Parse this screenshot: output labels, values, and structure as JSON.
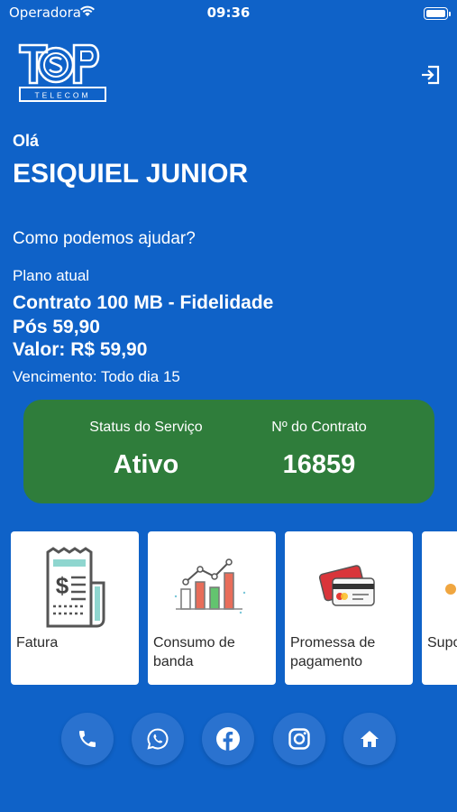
{
  "status_bar": {
    "carrier": "Operadora",
    "time": "09:36"
  },
  "header": {
    "logo_main": "TOP",
    "logo_sub": "TELECOM",
    "logout_icon": "logout-icon"
  },
  "user": {
    "greeting": "Olá",
    "name": "ESIQUIEL JUNIOR",
    "help_text": "Como podemos ajudar?"
  },
  "plan": {
    "label": "Plano atual",
    "name": "Contrato 100 MB - Fidelidade Pós 59,90",
    "value": "Valor: R$ 59,90",
    "due_date": "Vencimento: Todo dia 15"
  },
  "status_card": {
    "service_status_label": "Status do Serviço",
    "service_status_value": "Ativo",
    "contract_label": "Nº do Contrato",
    "contract_value": "16859",
    "color": "#2f7d3b"
  },
  "services": [
    {
      "label": "Fatura",
      "icon": "invoice-icon"
    },
    {
      "label": "Consumo de banda",
      "icon": "bandwidth-chart-icon"
    },
    {
      "label": "Promessa de pagamento",
      "icon": "credit-cards-icon"
    },
    {
      "label": "Suporte",
      "icon": "support-icon"
    }
  ],
  "bottom_actions": [
    {
      "icon": "phone-icon"
    },
    {
      "icon": "whatsapp-icon"
    },
    {
      "icon": "facebook-icon"
    },
    {
      "icon": "instagram-icon"
    },
    {
      "icon": "home-icon"
    }
  ],
  "colors": {
    "background": "#0f62c8",
    "button": "#2a72cf",
    "card": "#ffffff"
  }
}
